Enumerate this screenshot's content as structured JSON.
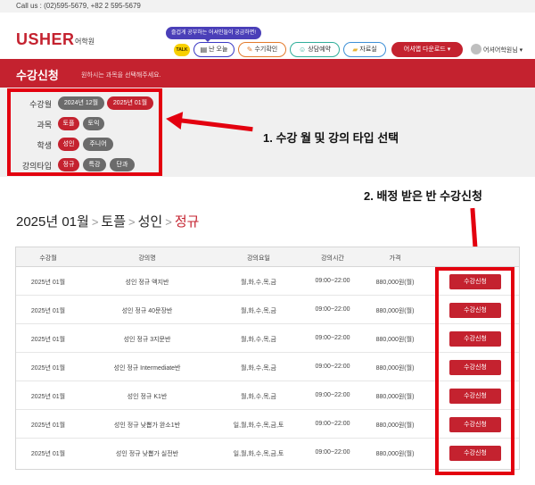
{
  "topbar": {
    "call_text": "Call us : (02)595-5679, +82 2 595-5679"
  },
  "header": {
    "logo": "USHER",
    "logo_sub": "어학원",
    "tooltip": "즐겁게 공부하는 어셔인들이 궁금하면!",
    "talk_icon": "TALK",
    "nav": [
      {
        "label": "난 오늘",
        "icon": "calendar-icon"
      },
      {
        "label": "수기확인",
        "icon": "pencil-icon"
      },
      {
        "label": "상담예약",
        "icon": "person-icon"
      },
      {
        "label": "자료실",
        "icon": "folder-icon"
      },
      {
        "label": "어셔앱 다운로드 ▾",
        "icon": "download-icon"
      }
    ],
    "user": "어셔어학원님 ▾"
  },
  "banner": {
    "title": "수강신청",
    "subtitle": "원하시는 과목을 선택해주세요."
  },
  "filters": [
    {
      "label": "수강월",
      "options": [
        {
          "text": "2024년 12월",
          "selected": false
        },
        {
          "text": "2025년 01월",
          "selected": true
        }
      ]
    },
    {
      "label": "과목",
      "options": [
        {
          "text": "토플",
          "selected": true
        },
        {
          "text": "토익",
          "selected": false
        }
      ]
    },
    {
      "label": "학생",
      "options": [
        {
          "text": "성인",
          "selected": true
        },
        {
          "text": "주니어",
          "selected": false
        }
      ]
    },
    {
      "label": "강의타입",
      "options": [
        {
          "text": "정규",
          "selected": true
        },
        {
          "text": "특강",
          "selected": false
        },
        {
          "text": "단과",
          "selected": false
        }
      ]
    }
  ],
  "annotations": {
    "step1": "1. 수강 월 및 강의 타입 선택",
    "step2": "2. 배정 받은 반 수강신청"
  },
  "breadcrumb": [
    "2025년 01월",
    "토플",
    "성인",
    "정규"
  ],
  "breadcrumb_sep": ">",
  "table": {
    "headers": [
      "수강월",
      "강의명",
      "강의요일",
      "강의시간",
      "가격",
      ""
    ],
    "button_label": "수강신청",
    "rows": [
      {
        "month": "2025년 01월",
        "name": "성인 정규 액지반",
        "days": "월,화,수,목,금",
        "time": "09:00~22:00",
        "price": "880,000원(월)"
      },
      {
        "month": "2025년 01월",
        "name": "성인 정규 40문장반",
        "days": "월,화,수,목,금",
        "time": "09:00~22:00",
        "price": "880,000원(월)"
      },
      {
        "month": "2025년 01월",
        "name": "성인 정규 3지문반",
        "days": "월,화,수,목,금",
        "time": "09:00~22:00",
        "price": "880,000원(월)"
      },
      {
        "month": "2025년 01월",
        "name": "성인 정규 Intermediate반",
        "days": "월,화,수,목,금",
        "time": "09:00~22:00",
        "price": "880,000원(월)"
      },
      {
        "month": "2025년 01월",
        "name": "성인 정규 K1반",
        "days": "월,화,수,목,금",
        "time": "09:00~22:00",
        "price": "880,000원(월)"
      },
      {
        "month": "2025년 01월",
        "name": "성인 정규 낮뽑가 완소1반",
        "days": "일,월,화,수,목,금,토",
        "time": "09:00~22:00",
        "price": "880,000원(월)"
      },
      {
        "month": "2025년 01월",
        "name": "성인 정규 낮뽑가 실전반",
        "days": "일,월,화,수,목,금,토",
        "time": "09:00~22:00",
        "price": "880,000원(월)"
      }
    ]
  },
  "colors": {
    "brand": "#c4222f",
    "highlight": "#e3000f",
    "panel": "#f0f0f0"
  }
}
